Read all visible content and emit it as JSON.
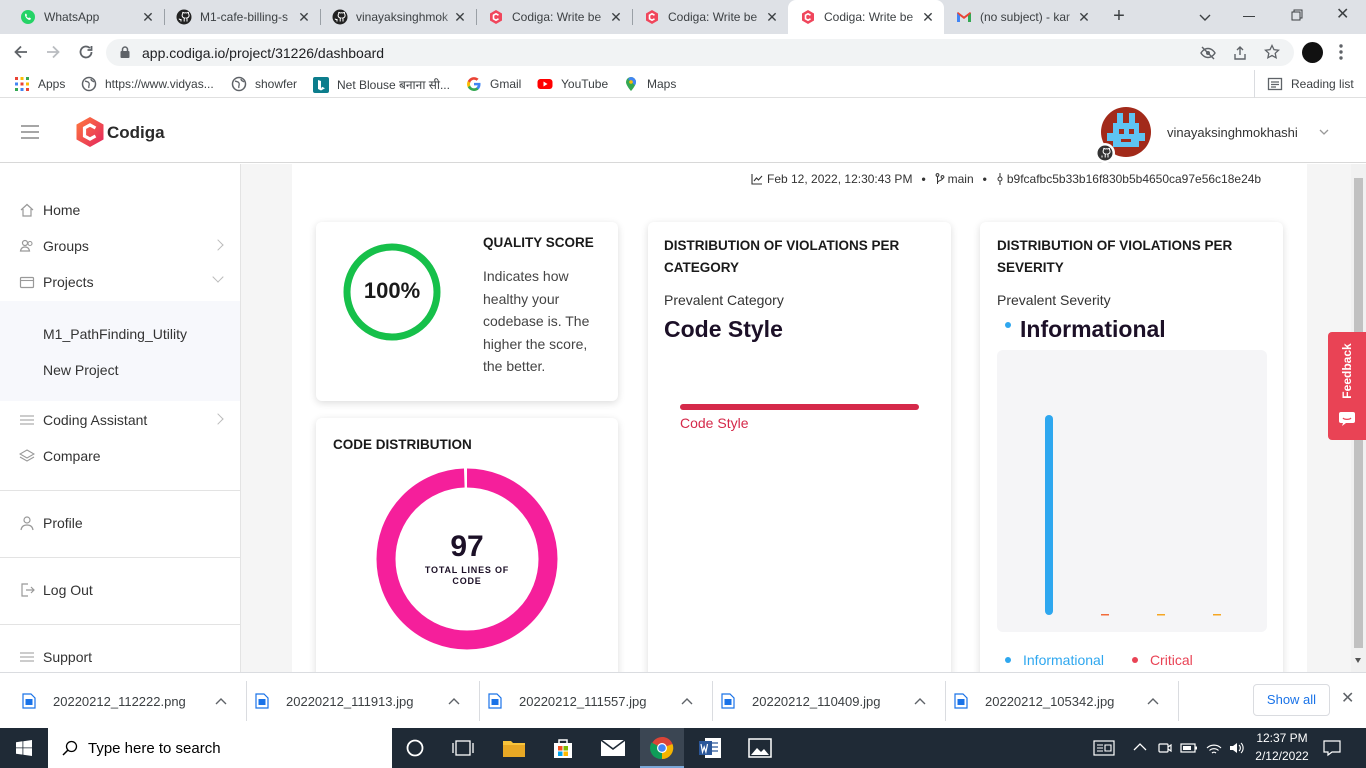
{
  "browser": {
    "tabs": [
      {
        "title": "WhatsApp",
        "icon": "whatsapp-icon"
      },
      {
        "title": "M1-cafe-billing-s",
        "icon": "github-icon"
      },
      {
        "title": "vinayaksinghmok",
        "icon": "github-icon"
      },
      {
        "title": "Codiga: Write be",
        "icon": "codiga-icon"
      },
      {
        "title": "Codiga: Write be",
        "icon": "codiga-icon"
      },
      {
        "title": "Codiga: Write be",
        "icon": "codiga-icon",
        "active": true
      },
      {
        "title": "(no subject) - kar",
        "icon": "gmail-icon"
      }
    ],
    "url": "app.codiga.io/project/31226/dashboard",
    "bookmarks": [
      {
        "label": "Apps",
        "icon": "apps-grid-icon"
      },
      {
        "label": "https://www.vidyas...",
        "icon": "globe-icon"
      },
      {
        "label": "showfer",
        "icon": "globe-icon"
      },
      {
        "label": "Net Blouse बनाना सी...",
        "icon": "bing-icon"
      },
      {
        "label": "Gmail",
        "icon": "google-icon"
      },
      {
        "label": "YouTube",
        "icon": "youtube-icon"
      },
      {
        "label": "Maps",
        "icon": "maps-icon"
      }
    ],
    "reading_list": "Reading list"
  },
  "app": {
    "brand": "Codiga",
    "username": "vinayaksinghmokhashi",
    "sidebar": {
      "home": "Home",
      "groups": "Groups",
      "projects": "Projects",
      "project_items": [
        "M1_PathFinding_Utility",
        "New Project"
      ],
      "coding_assistant": "Coding Assistant",
      "compare": "Compare",
      "profile": "Profile",
      "logout": "Log Out",
      "support": "Support"
    },
    "meta": {
      "timestamp": "Feb 12, 2022, 12:30:43 PM",
      "branch": "main",
      "commit": "b9fcafbc5b33b16f830b5b4650ca97e56c18e24b"
    },
    "quality": {
      "title": "QUALITY SCORE",
      "value": "100%",
      "score": 1.0,
      "description": "Indicates how healthy your codebase is. The higher the score, the better."
    },
    "code_distribution": {
      "title": "CODE DISTRIBUTION",
      "value": "97",
      "caption": "TOTAL LINES OF CODE"
    },
    "category": {
      "title": "DISTRIBUTION OF VIOLATIONS PER CATEGORY",
      "prevalent_label": "Prevalent Category",
      "prevalent_value": "Code Style",
      "bar_label": "Code Style",
      "bar_fraction": 1.0,
      "color": "#d5294a"
    },
    "severity": {
      "title": "DISTRIBUTION OF VIOLATIONS PER SEVERITY",
      "prevalent_label": "Prevalent Severity",
      "prevalent_value": "Informational",
      "legend": [
        {
          "label": "Informational",
          "color": "#2ea7ef"
        },
        {
          "label": "Critical",
          "color": "#e94355"
        }
      ]
    },
    "feedback": "Feedback"
  },
  "chart_data": [
    {
      "type": "bar",
      "categories": [
        "Informational",
        "",
        "",
        ""
      ],
      "values": [
        1,
        0,
        0,
        0
      ],
      "colors": [
        "#2ea7ef",
        "#f26b3a",
        "#f5a623",
        "#f5a623"
      ]
    }
  ],
  "downloads": {
    "files": [
      "20220212_112222.png",
      "20220212_111913.jpg",
      "20220212_111557.jpg",
      "20220212_110409.jpg",
      "20220212_105342.jpg"
    ],
    "show_all": "Show all"
  },
  "taskbar": {
    "search_placeholder": "Type here to search",
    "time": "12:37 PM",
    "date": "2/12/2022"
  }
}
